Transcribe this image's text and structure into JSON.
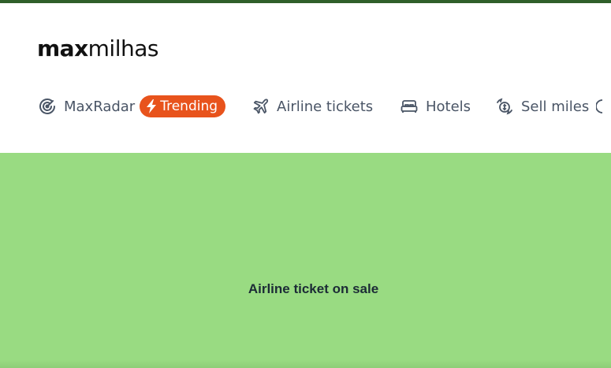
{
  "brand": {
    "logo_bold": "max",
    "logo_light": "milhas",
    "topbar_color": "#2f5f2a",
    "accent_color": "#e8531c",
    "hero_color": "#99db82"
  },
  "nav": {
    "items": [
      {
        "label": "MaxRadar",
        "icon": "radar-icon",
        "badge": "Trending",
        "badge_icon": "lightning-icon"
      },
      {
        "label": "Airline tickets",
        "icon": "airplane-icon"
      },
      {
        "label": "Hotels",
        "icon": "bed-icon"
      },
      {
        "label": "Sell miles",
        "icon": "coins-cycle-icon"
      }
    ]
  },
  "hero": {
    "title": "Airline ticket on sale"
  }
}
